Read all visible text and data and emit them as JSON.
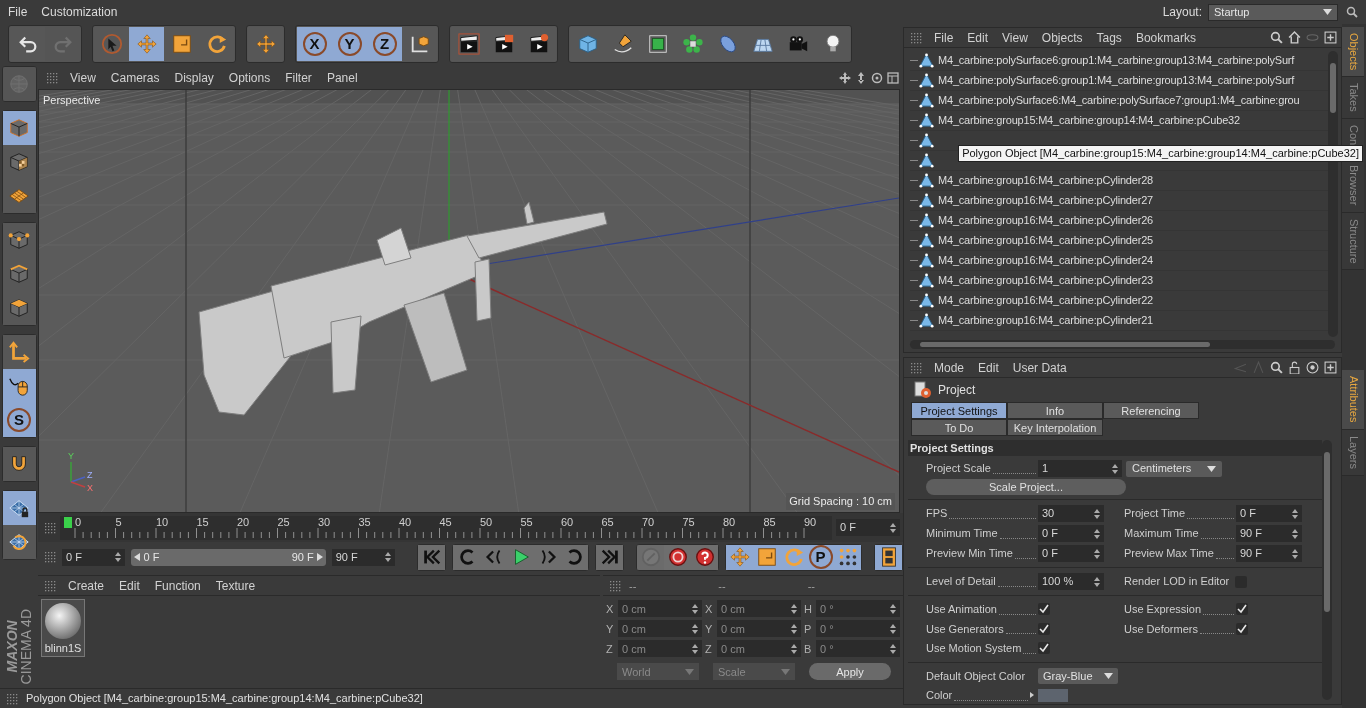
{
  "menu_bar": {
    "items": [
      "File",
      "Customization"
    ],
    "layout_label": "Layout:",
    "layout_value": "Startup"
  },
  "toolbar": [
    {
      "buttons": [
        {
          "kind": "undo",
          "selected": false,
          "disabled": false
        },
        {
          "kind": "redo",
          "selected": false,
          "disabled": true
        }
      ]
    },
    {
      "buttons": [
        {
          "kind": "live-select",
          "selected": false,
          "disabled": false
        },
        {
          "kind": "move",
          "selected": true,
          "disabled": false
        },
        {
          "kind": "scale",
          "selected": false,
          "disabled": false
        },
        {
          "kind": "rotate",
          "selected": false,
          "disabled": false
        }
      ]
    },
    {
      "buttons": [
        {
          "kind": "move",
          "selected": false,
          "disabled": false
        }
      ]
    },
    {
      "buttons": [
        {
          "kind": "axis",
          "label": "X",
          "selected": true,
          "disabled": false
        },
        {
          "kind": "axis",
          "label": "Y",
          "selected": true,
          "disabled": false
        },
        {
          "kind": "axis",
          "label": "Z",
          "selected": true,
          "disabled": false
        },
        {
          "kind": "coordinate-system",
          "selected": false,
          "disabled": false
        }
      ]
    },
    {
      "buttons": [
        {
          "kind": "render-view",
          "selected": false,
          "disabled": false
        },
        {
          "kind": "render-picture",
          "selected": false,
          "disabled": false
        },
        {
          "kind": "render-settings",
          "selected": false,
          "disabled": false
        }
      ]
    },
    {
      "buttons": [
        {
          "kind": "cube",
          "selected": false,
          "disabled": false
        },
        {
          "kind": "pen",
          "selected": false,
          "disabled": false
        },
        {
          "kind": "subdivision",
          "selected": false,
          "disabled": false
        },
        {
          "kind": "cloner",
          "selected": false,
          "disabled": false
        },
        {
          "kind": "bend",
          "selected": false,
          "disabled": false
        },
        {
          "kind": "floor",
          "selected": false,
          "disabled": false
        },
        {
          "kind": "camera",
          "selected": false,
          "disabled": false
        },
        {
          "kind": "light",
          "selected": false,
          "disabled": false
        }
      ]
    }
  ],
  "tool_palette": [
    {
      "buttons": [
        {
          "kind": "make-editable",
          "selected": false,
          "disabled": true
        }
      ]
    },
    {
      "buttons": [
        {
          "kind": "model",
          "selected": true,
          "disabled": false
        },
        {
          "kind": "texture",
          "selected": false,
          "disabled": false
        },
        {
          "kind": "workplane",
          "selected": false,
          "disabled": false
        }
      ]
    },
    {
      "buttons": [
        {
          "kind": "points",
          "selected": false,
          "disabled": false
        },
        {
          "kind": "edges",
          "selected": false,
          "disabled": false
        },
        {
          "kind": "polygons",
          "selected": false,
          "disabled": false
        }
      ]
    },
    {
      "buttons": [
        {
          "kind": "axis-mode",
          "selected": false,
          "disabled": false
        },
        {
          "kind": "tweak",
          "selected": true,
          "disabled": false
        },
        {
          "kind": "solo",
          "label": "S",
          "selected": true,
          "disabled": false
        }
      ]
    },
    {
      "buttons": [
        {
          "kind": "snap",
          "selected": false,
          "disabled": false
        }
      ]
    },
    {
      "buttons": [
        {
          "kind": "workplane-lock",
          "selected": true,
          "disabled": false
        },
        {
          "kind": "workplane-align",
          "selected": false,
          "disabled": false
        }
      ]
    }
  ],
  "logo": {
    "brand": "MAXON",
    "product": "CINEMA 4D"
  },
  "viewport": {
    "menu": [
      "View",
      "Cameras",
      "Display",
      "Options",
      "Filter",
      "Panel"
    ],
    "camera": "Perspective",
    "grid_spacing": "Grid Spacing : 10 cm",
    "axis_labels": [
      "Y",
      "Z",
      "X"
    ]
  },
  "timeline": {
    "ticks": [
      "0",
      "5",
      "10",
      "15",
      "20",
      "25",
      "30",
      "35",
      "40",
      "45",
      "50",
      "55",
      "60",
      "65",
      "70",
      "75",
      "80",
      "85",
      "90"
    ],
    "playhead": {
      "level": 0
    },
    "current_frame": "0 F"
  },
  "playback": {
    "start": "0 F",
    "range_start": "0 F",
    "range_end": "90 F",
    "range": {
      "level": 1
    },
    "end": "90 F",
    "groups": [
      {
        "buttons": [
          {
            "kind": "go-start",
            "selected": false,
            "disabled": false
          }
        ]
      },
      {
        "buttons": [
          {
            "kind": "prev-key",
            "selected": false,
            "disabled": false
          },
          {
            "kind": "prev-frame",
            "selected": false,
            "disabled": false
          },
          {
            "kind": "play",
            "selected": false,
            "disabled": false
          },
          {
            "kind": "next-frame",
            "selected": false,
            "disabled": false
          },
          {
            "kind": "next-key",
            "selected": false,
            "disabled": false
          }
        ]
      },
      {
        "buttons": [
          {
            "kind": "go-end",
            "selected": false,
            "disabled": false
          }
        ]
      },
      {
        "buttons": [
          {
            "kind": "record",
            "selected": false,
            "disabled": true
          },
          {
            "kind": "autokey",
            "selected": false,
            "disabled": false
          },
          {
            "kind": "help",
            "selected": false,
            "disabled": false
          }
        ]
      },
      {
        "buttons": [
          {
            "kind": "move",
            "selected": true,
            "disabled": false
          },
          {
            "kind": "scale",
            "selected": true,
            "disabled": false
          },
          {
            "kind": "rotate",
            "selected": true,
            "disabled": false
          },
          {
            "kind": "parameter",
            "label": "P",
            "selected": true,
            "disabled": false
          },
          {
            "kind": "dots",
            "selected": true,
            "disabled": false
          }
        ]
      },
      {
        "buttons": [
          {
            "kind": "film",
            "selected": true,
            "disabled": false
          }
        ]
      }
    ]
  },
  "material_manager": {
    "menu": [
      "Create",
      "Edit",
      "Function",
      "Texture"
    ],
    "materials": [
      "blinn1S"
    ]
  },
  "coordinates": {
    "headers": [
      "--",
      "--",
      "--"
    ],
    "rows": [
      {
        "labels": [
          "X",
          "X",
          "H"
        ],
        "values": [
          "0 cm",
          "0 cm",
          "0 °"
        ]
      },
      {
        "labels": [
          "Y",
          "Y",
          "P"
        ],
        "values": [
          "0 cm",
          "0 cm",
          "0 °"
        ]
      },
      {
        "labels": [
          "Z",
          "Z",
          "B"
        ],
        "values": [
          "0 cm",
          "0 cm",
          "0 °"
        ]
      }
    ],
    "dropdowns": [
      "World",
      "Scale"
    ],
    "apply": "Apply"
  },
  "status_bar": "Polygon Object [M4_carbine:group15:M4_carbine:group14:M4_carbine:pCube32]",
  "objects_panel": {
    "menu": [
      "File",
      "Edit",
      "View",
      "Objects",
      "Tags",
      "Bookmarks"
    ],
    "rows": [
      {
        "kind": "object",
        "name": "M4_carbine:polySurface6:group1:M4_carbine:group13:M4_carbine:polySurf"
      },
      {
        "kind": "object",
        "name": "M4_carbine:polySurface6:group1:M4_carbine:group13:M4_carbine:polySurf"
      },
      {
        "kind": "object",
        "name": "M4_carbine:polySurface6:M4_carbine:polySurface7:group1:M4_carbine:grou"
      },
      {
        "kind": "object",
        "name": "M4_carbine:group15:M4_carbine:group14:M4_carbine:pCube32"
      },
      {
        "kind": "covered"
      },
      {
        "kind": "covered"
      },
      {
        "kind": "object",
        "name": "M4_carbine:group16:M4_carbine:pCylinder28"
      },
      {
        "kind": "object",
        "name": "M4_carbine:group16:M4_carbine:pCylinder27"
      },
      {
        "kind": "object",
        "name": "M4_carbine:group16:M4_carbine:pCylinder26"
      },
      {
        "kind": "object",
        "name": "M4_carbine:group16:M4_carbine:pCylinder25"
      },
      {
        "kind": "object",
        "name": "M4_carbine:group16:M4_carbine:pCylinder24"
      },
      {
        "kind": "object",
        "name": "M4_carbine:group16:M4_carbine:pCylinder23"
      },
      {
        "kind": "object",
        "name": "M4_carbine:group16:M4_carbine:pCylinder22"
      },
      {
        "kind": "object",
        "name": "M4_carbine:group16:M4_carbine:pCylinder21"
      }
    ],
    "tooltip": "Polygon Object [M4_carbine:group15:M4_carbine:group14:M4_carbine:pCube32]"
  },
  "side_tabs_objects": [
    {
      "label": "Objects",
      "selected": true
    },
    {
      "label": "Takes",
      "selected": false
    },
    {
      "label": "Con",
      "label_continued": "Browser",
      "selected": false
    },
    {
      "label": "Structure",
      "selected": false
    }
  ],
  "attributes": {
    "menu": [
      "Mode",
      "Edit",
      "User Data"
    ],
    "object_title": "Project",
    "tabs": [
      {
        "label": "Project Settings",
        "selected": true
      },
      {
        "label": "Info",
        "selected": false
      },
      {
        "label": "Referencing",
        "selected": false
      },
      {
        "label": "To Do",
        "selected": false
      },
      {
        "label": "Key Interpolation",
        "selected": false
      }
    ],
    "section_title": "Project Settings",
    "project_scale": {
      "label": "Project Scale",
      "value": "1",
      "unit": "Centimeters"
    },
    "scale_button": "Scale Project...",
    "time_fields": [
      {
        "label": "FPS",
        "value": "30"
      },
      {
        "label": "Project Time",
        "value": "0 F"
      },
      {
        "label": "Minimum Time",
        "value": "0 F"
      },
      {
        "label": "Maximum Time",
        "value": "90 F"
      },
      {
        "label": "Preview Min Time",
        "value": "0 F"
      },
      {
        "label": "Preview Max Time",
        "value": "90 F"
      }
    ],
    "level_of_detail": {
      "label": "Level of Detail",
      "value": "100 %"
    },
    "render_lod": {
      "label": "Render LOD in Editor",
      "checked": false
    },
    "checkboxes": [
      {
        "label": "Use Animation",
        "checked": true
      },
      {
        "label": "Use Expression",
        "checked": true
      },
      {
        "label": "Use Generators",
        "checked": true
      },
      {
        "label": "Use Deformers",
        "checked": true
      },
      {
        "label": "Use Motion System",
        "checked": true
      }
    ],
    "default_color": {
      "label": "Default Object Color",
      "value": "Gray-Blue"
    },
    "color": {
      "label": "Color",
      "color": "#5d646e"
    }
  },
  "side_tabs_attributes": [
    {
      "label": "Attributes",
      "selected": true
    },
    {
      "label": "Layers",
      "selected": false
    }
  ]
}
